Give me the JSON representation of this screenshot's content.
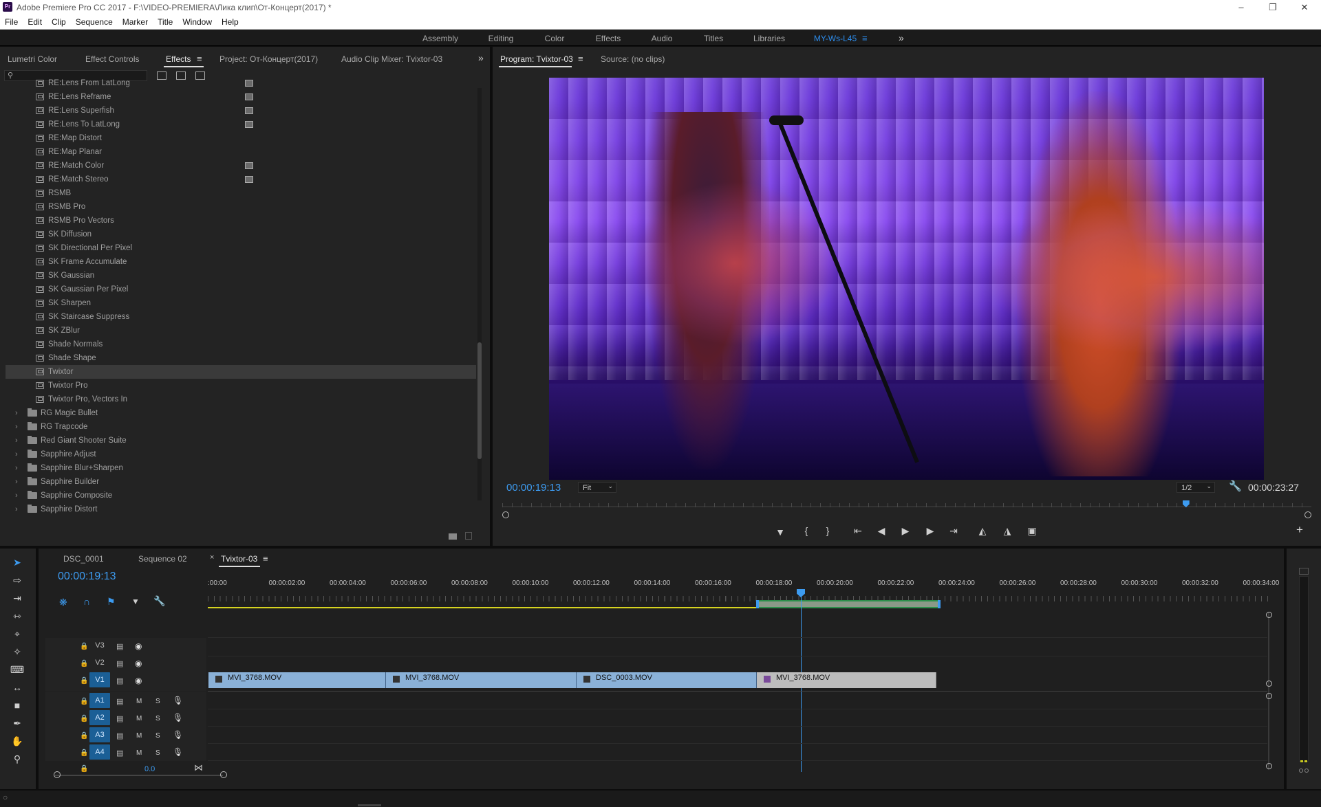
{
  "window": {
    "app_icon": "Pr",
    "title": "Adobe Premiere Pro CC 2017 - F:\\VIDEO-PREMIERA\\Лика клип\\От-Концерт(2017) *"
  },
  "menu": [
    "File",
    "Edit",
    "Clip",
    "Sequence",
    "Marker",
    "Title",
    "Window",
    "Help"
  ],
  "workspaces": [
    "Assembly",
    "Editing",
    "Color",
    "Effects",
    "Audio",
    "Titles",
    "Libraries",
    "MY-Ws-L45"
  ],
  "active_workspace": "MY-Ws-L45",
  "left_tabs": [
    "Lumetri Color",
    "Effect Controls",
    "Effects",
    "Project: От-Концерт(2017)",
    "Audio Clip Mixer: Tvixtor-03"
  ],
  "effects": {
    "items": [
      {
        "label": "RE:Lens From LatLong",
        "accel": true
      },
      {
        "label": "RE:Lens Reframe",
        "accel": true
      },
      {
        "label": "RE:Lens Superfish",
        "accel": true
      },
      {
        "label": "RE:Lens To LatLong",
        "accel": true
      },
      {
        "label": "RE:Map Distort",
        "accel": false
      },
      {
        "label": "RE:Map Planar",
        "accel": false
      },
      {
        "label": "RE:Match Color",
        "accel": true
      },
      {
        "label": "RE:Match Stereo",
        "accel": true
      },
      {
        "label": "RSMB",
        "accel": false
      },
      {
        "label": "RSMB Pro",
        "accel": false
      },
      {
        "label": "RSMB Pro Vectors",
        "accel": false
      },
      {
        "label": "SK Diffusion",
        "accel": false
      },
      {
        "label": "SK Directional Per Pixel",
        "accel": false
      },
      {
        "label": "SK Frame Accumulate",
        "accel": false
      },
      {
        "label": "SK Gaussian",
        "accel": false
      },
      {
        "label": "SK Gaussian Per Pixel",
        "accel": false
      },
      {
        "label": "SK Sharpen",
        "accel": false
      },
      {
        "label": "SK Staircase Suppress",
        "accel": false
      },
      {
        "label": "SK ZBlur",
        "accel": false
      },
      {
        "label": "Shade Normals",
        "accel": false
      },
      {
        "label": "Shade Shape",
        "accel": false
      },
      {
        "label": "Twixtor",
        "accel": false,
        "selected": true
      },
      {
        "label": "Twixtor Pro",
        "accel": false
      },
      {
        "label": "Twixtor Pro, Vectors In",
        "accel": false
      }
    ],
    "folders": [
      "RG Magic Bullet",
      "RG Trapcode",
      "Red Giant Shooter Suite",
      "Sapphire Adjust",
      "Sapphire Blur+Sharpen",
      "Sapphire Builder",
      "Sapphire Composite",
      "Sapphire Distort"
    ]
  },
  "monitor": {
    "tabs": [
      "Program: Tvixtor-03",
      "Source: (no clips)"
    ],
    "current_time": "00:00:19:13",
    "fit": "Fit",
    "resolution": "1/2",
    "duration": "00:00:23:27",
    "playhead_fraction": 0.845
  },
  "timeline": {
    "tabs": [
      "DSC_0001",
      "Sequence 02",
      "Tvixtor-03"
    ],
    "timecode": "00:00:19:13",
    "ruler": [
      ":00:00",
      "00:00:02:00",
      "00:00:04:00",
      "00:00:06:00",
      "00:00:08:00",
      "00:00:10:00",
      "00:00:12:00",
      "00:00:14:00",
      "00:00:16:00",
      "00:00:18:00",
      "00:00:20:00",
      "00:00:22:00",
      "00:00:24:00",
      "00:00:26:00",
      "00:00:28:00",
      "00:00:30:00",
      "00:00:32:00",
      "00:00:34:00"
    ],
    "video_tracks": [
      "V3",
      "V2",
      "V1"
    ],
    "audio_tracks": [
      "A1",
      "A2",
      "A3",
      "A4"
    ],
    "mute_label": "M",
    "solo_label": "S",
    "master_value": "0.0",
    "clips": [
      "MVI_3768.MOV",
      "MVI_3768.MOV",
      "DSC_0003.MOV",
      "MVI_3768.MOV"
    ]
  }
}
